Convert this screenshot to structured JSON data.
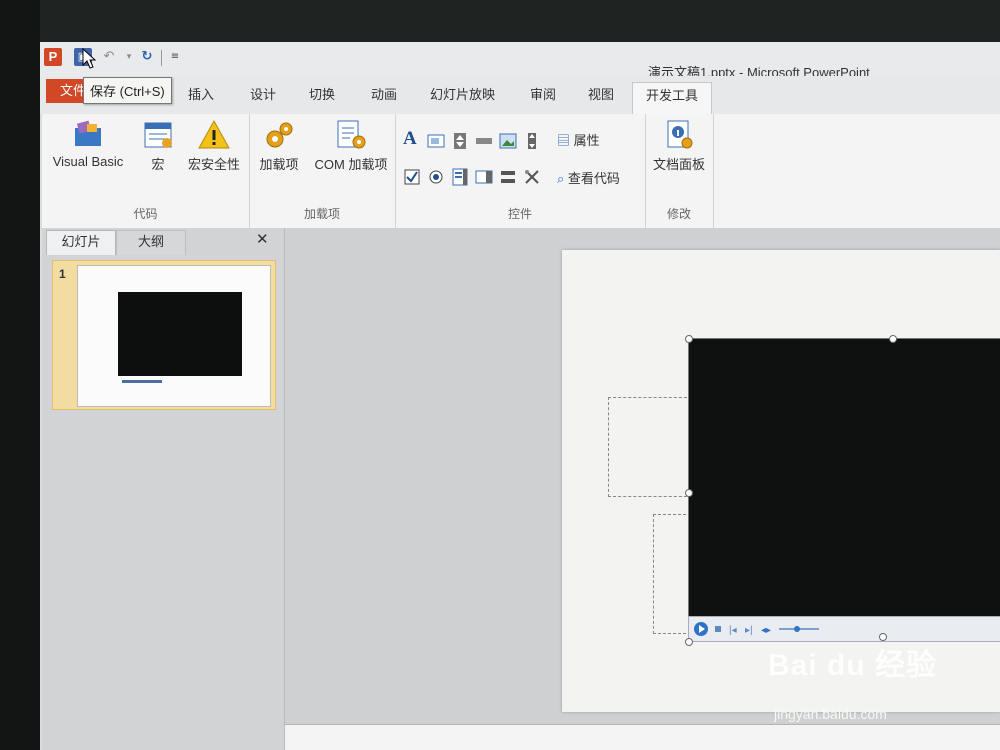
{
  "window": {
    "title": "演示文稿1.pptx - Microsoft PowerPoint",
    "app_logo": "P"
  },
  "quick_access": {
    "save_tooltip": "保存 (Ctrl+S)",
    "icons": [
      "save-icon",
      "undo-icon",
      "redo-icon",
      "customize-icon"
    ]
  },
  "tabs": {
    "file": "文件",
    "items": [
      "插入",
      "设计",
      "切换",
      "动画",
      "幻灯片放映",
      "审阅",
      "视图"
    ],
    "active": "开发工具"
  },
  "ribbon": {
    "code_group": {
      "label": "代码",
      "visual_basic": "Visual Basic",
      "macro": "宏",
      "macro_security": "宏安全性"
    },
    "addins_group": {
      "label": "加载项",
      "addins": "加载项",
      "com_addins": "COM 加载项"
    },
    "controls_group": {
      "label": "控件",
      "properties": "属性",
      "view_code": "查看代码"
    },
    "modify_group": {
      "label": "修改",
      "doc_panel": "文档面板"
    }
  },
  "left_panel": {
    "tab_slides": "幻灯片",
    "tab_outline": "大纲",
    "close": "✕",
    "slide_number": "1"
  },
  "watermark": {
    "brand": "Bai du 经验",
    "url": "jingyan.baidu.com"
  },
  "colors": {
    "file_tab": "#d24726",
    "selected_thumb": "#f2dca2",
    "save_button": "#3f65a8"
  }
}
